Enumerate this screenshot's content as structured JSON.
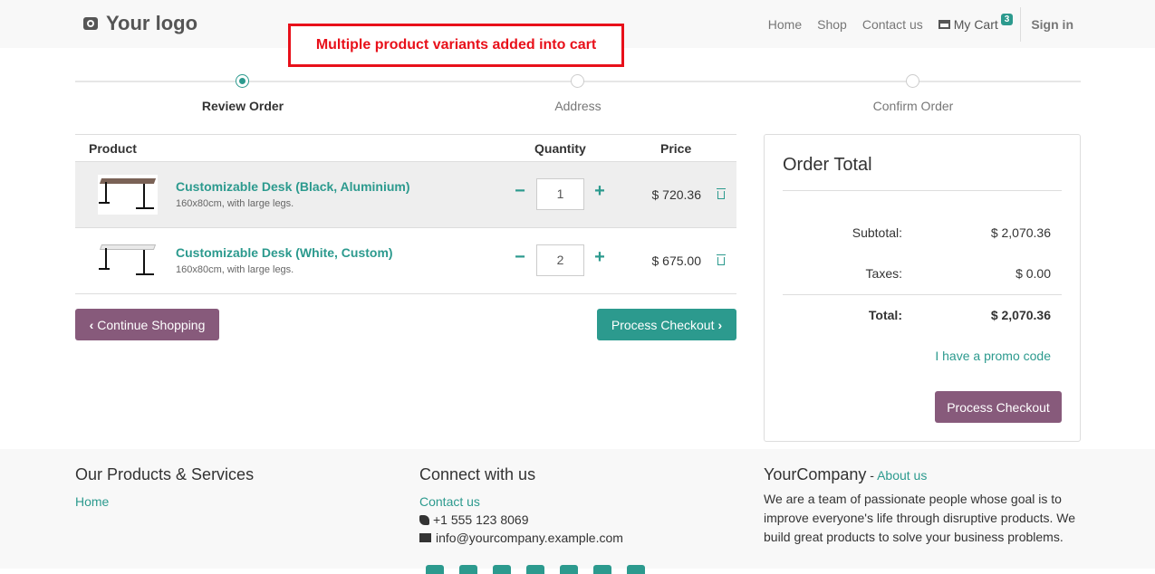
{
  "header": {
    "logo_text": "Your logo",
    "nav": [
      "Home",
      "Shop",
      "Contact us"
    ],
    "cart_label": "My Cart",
    "cart_count": "3",
    "signin": "Sign in"
  },
  "annotation": "Multiple product variants added into cart",
  "steps": [
    {
      "label": "Review Order",
      "active": true
    },
    {
      "label": "Address",
      "active": false
    },
    {
      "label": "Confirm Order",
      "active": false
    }
  ],
  "cart": {
    "headers": {
      "product": "Product",
      "quantity": "Quantity",
      "price": "Price"
    },
    "items": [
      {
        "name": "Customizable Desk (Black, Aluminium)",
        "desc": "160x80cm, with large legs.",
        "qty": "1",
        "price": "$ 720.36",
        "desk_color": "#7a6256"
      },
      {
        "name": "Customizable Desk (White, Custom)",
        "desc": "160x80cm, with large legs.",
        "qty": "2",
        "price": "$ 675.00",
        "desk_color": "#e9e9e9"
      }
    ],
    "continue_label": "Continue Shopping",
    "checkout_label": "Process Checkout"
  },
  "order_total": {
    "title": "Order Total",
    "subtotal_label": "Subtotal:",
    "subtotal": "$ 2,070.36",
    "taxes_label": "Taxes:",
    "taxes": "$ 0.00",
    "total_label": "Total:",
    "total": "$ 2,070.36",
    "promo": "I have a promo code",
    "checkout_label": "Process Checkout"
  },
  "footer": {
    "col1_title": "Our Products & Services",
    "col1_link": "Home",
    "col2_title": "Connect with us",
    "col2_link": "Contact us",
    "phone": "+1 555 123 8069",
    "email": "info@yourcompany.example.com",
    "col3_title": "YourCompany",
    "col3_sep": " - ",
    "col3_link": "About us",
    "col3_text": "We are a team of passionate people whose goal is to improve everyone's life through disruptive products. We build great products to solve your business problems."
  },
  "colors": {
    "accent": "#2c9a8e",
    "secondary": "#875a7b",
    "annotation": "#e8101a"
  }
}
